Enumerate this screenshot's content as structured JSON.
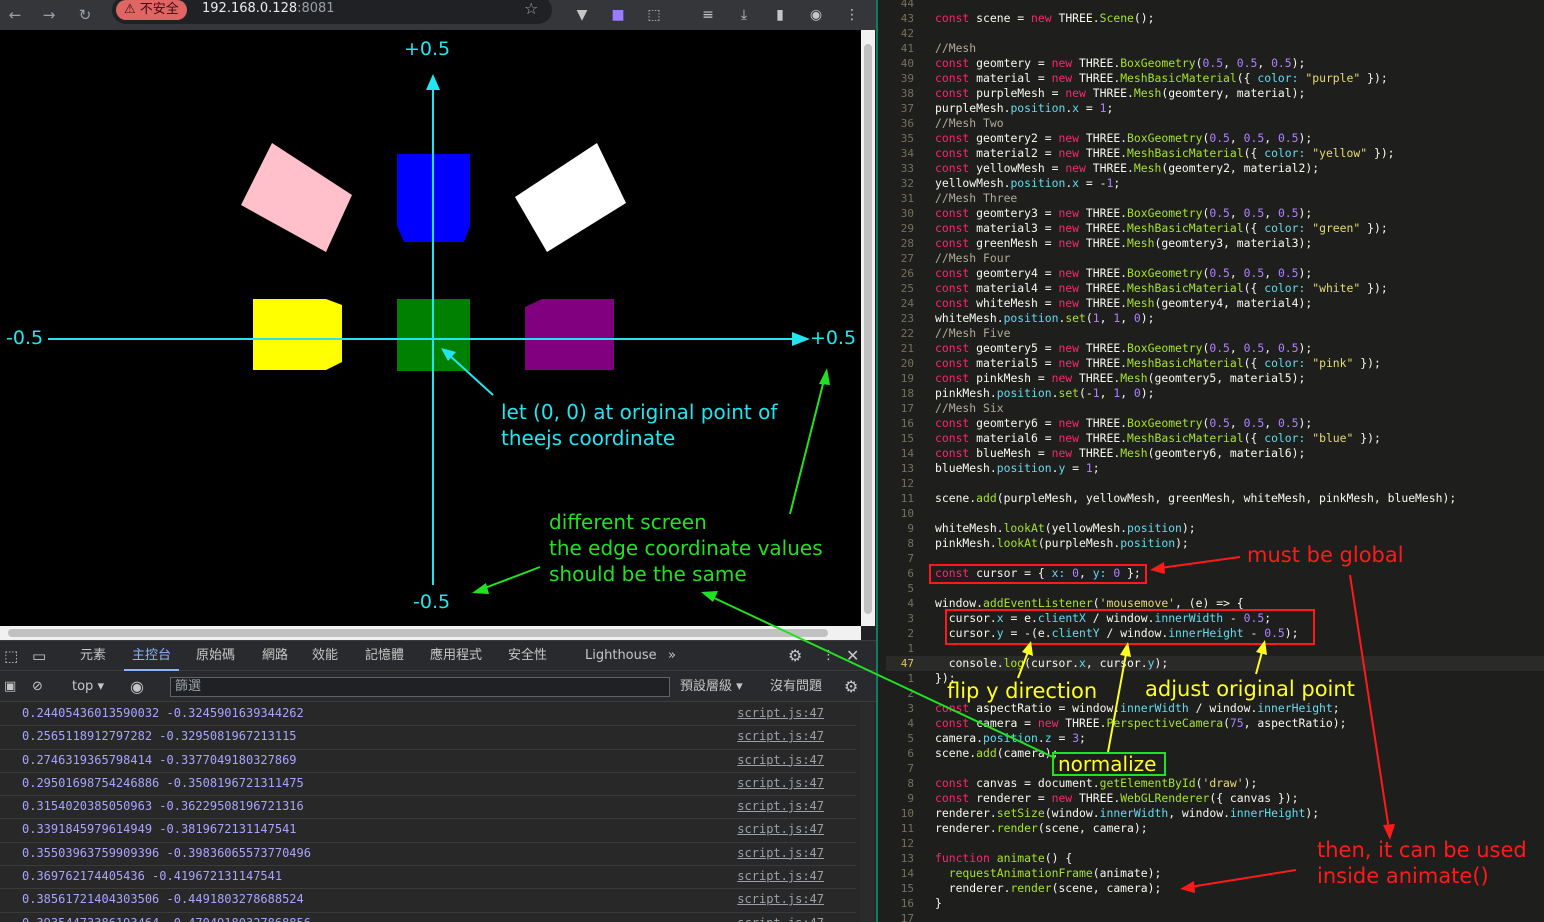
{
  "browser": {
    "insecure_label": "⚠ 不安全",
    "url_host": "192.168.0.128",
    "url_port": ":8081"
  },
  "scene": {
    "axis_labels": {
      "top": "+0.5",
      "bottom": "-0.5",
      "left": "-0.5",
      "right": "+0.5"
    },
    "note_origin": [
      "let (0, 0) at original point of",
      "theejs coordinate"
    ],
    "note_screen": [
      "different screen",
      "the edge coordinate values",
      "should be the same"
    ],
    "colors": {
      "axis": "#21e6f0",
      "note_green": "#22e022",
      "pink": "#ffc0cb",
      "blue": "#0000ff",
      "white": "#ffffff",
      "yellow": "#ffff00",
      "green": "#008000",
      "purple": "#800080"
    }
  },
  "devtools": {
    "tabs": [
      "元素",
      "主控台",
      "原始碼",
      "網路",
      "效能",
      "記憶體",
      "應用程式",
      "安全性",
      "Lighthouse"
    ],
    "active_tab": "主控台",
    "context": "top",
    "filter_placeholder": "篩選",
    "levels": "預設層級 ▾",
    "issues": "沒有問題",
    "logs": [
      {
        "msg": "0.24405436013590032 -0.3245901639344262",
        "src": "script.js:47"
      },
      {
        "msg": "0.2565118912797282 -0.3295081967213115",
        "src": "script.js:47"
      },
      {
        "msg": "0.2746319365798414 -0.3377049180327869",
        "src": "script.js:47"
      },
      {
        "msg": "0.29501698754246886 -0.3508196721311475",
        "src": "script.js:47"
      },
      {
        "msg": "0.3154020385050963 -0.36229508196721316",
        "src": "script.js:47"
      },
      {
        "msg": "0.3391845979614949 -0.3819672131147541",
        "src": "script.js:47"
      },
      {
        "msg": "0.35503963759909396 -0.39836065573770496",
        "src": "script.js:47"
      },
      {
        "msg": "0.369762174405436 -0.419672131147541",
        "src": "script.js:47"
      },
      {
        "msg": "0.38561721404303506 -0.4491803278688524",
        "src": "script.js:47"
      },
      {
        "msg": "0.39354473386193464 -0.47049180327868856",
        "src": "script.js:47"
      }
    ]
  },
  "editor": {
    "lines": [
      {
        "n": "44",
        "html": ""
      },
      {
        "n": "43",
        "html": "<span class='kw'>const</span> scene = <span class='kw'>new</span> THREE.<span class='fn'>Scene</span>();"
      },
      {
        "n": "42",
        "html": ""
      },
      {
        "n": "41",
        "html": "<span class='cm'>//Mesh</span>"
      },
      {
        "n": "40",
        "html": "<span class='kw'>const</span> geomtery = <span class='kw'>new</span> THREE.<span class='fn'>BoxGeometry</span>(<span class='num'>0.5</span>, <span class='num'>0.5</span>, <span class='num'>0.5</span>);"
      },
      {
        "n": "39",
        "html": "<span class='kw'>const</span> material = <span class='kw'>new</span> THREE.<span class='fn'>MeshBasicMaterial</span>({ <span class='prop'>color:</span> <span class='str'>\"purple\"</span> });"
      },
      {
        "n": "38",
        "html": "<span class='kw'>const</span> purpleMesh = <span class='kw'>new</span> THREE.<span class='fn'>Mesh</span>(geomtery, material);"
      },
      {
        "n": "37",
        "html": "purpleMesh.<span class='prop'>position</span>.<span class='prop'>x</span> = <span class='num'>1</span>;"
      },
      {
        "n": "36",
        "html": "<span class='cm'>//Mesh Two</span>"
      },
      {
        "n": "35",
        "html": "<span class='kw'>const</span> geomtery2 = <span class='kw'>new</span> THREE.<span class='fn'>BoxGeometry</span>(<span class='num'>0.5</span>, <span class='num'>0.5</span>, <span class='num'>0.5</span>);"
      },
      {
        "n": "34",
        "html": "<span class='kw'>const</span> material2 = <span class='kw'>new</span> THREE.<span class='fn'>MeshBasicMaterial</span>({ <span class='prop'>color:</span> <span class='str'>\"yellow\"</span> });"
      },
      {
        "n": "33",
        "html": "<span class='kw'>const</span> yellowMesh = <span class='kw'>new</span> THREE.<span class='fn'>Mesh</span>(geomtery2, material2);"
      },
      {
        "n": "32",
        "html": "yellowMesh.<span class='prop'>position</span>.<span class='prop'>x</span> = -<span class='num'>1</span>;"
      },
      {
        "n": "31",
        "html": "<span class='cm'>//Mesh Three</span>"
      },
      {
        "n": "30",
        "html": "<span class='kw'>const</span> geomtery3 = <span class='kw'>new</span> THREE.<span class='fn'>BoxGeometry</span>(<span class='num'>0.5</span>, <span class='num'>0.5</span>, <span class='num'>0.5</span>);"
      },
      {
        "n": "29",
        "html": "<span class='kw'>const</span> material3 = <span class='kw'>new</span> THREE.<span class='fn'>MeshBasicMaterial</span>({ <span class='prop'>color:</span> <span class='str'>\"green\"</span> });"
      },
      {
        "n": "28",
        "html": "<span class='kw'>const</span> greenMesh = <span class='kw'>new</span> THREE.<span class='fn'>Mesh</span>(geomtery3, material3);"
      },
      {
        "n": "27",
        "html": "<span class='cm'>//Mesh Four</span>"
      },
      {
        "n": "26",
        "html": "<span class='kw'>const</span> geomtery4 = <span class='kw'>new</span> THREE.<span class='fn'>BoxGeometry</span>(<span class='num'>0.5</span>, <span class='num'>0.5</span>, <span class='num'>0.5</span>);"
      },
      {
        "n": "25",
        "html": "<span class='kw'>const</span> material4 = <span class='kw'>new</span> THREE.<span class='fn'>MeshBasicMaterial</span>({ <span class='prop'>color:</span> <span class='str'>\"white\"</span> });"
      },
      {
        "n": "24",
        "html": "<span class='kw'>const</span> whiteMesh = <span class='kw'>new</span> THREE.<span class='fn'>Mesh</span>(geomtery4, material4);"
      },
      {
        "n": "23",
        "html": "whiteMesh.<span class='prop'>position</span>.<span class='fn'>set</span>(<span class='num'>1</span>, <span class='num'>1</span>, <span class='num'>0</span>);"
      },
      {
        "n": "22",
        "html": "<span class='cm'>//Mesh Five</span>"
      },
      {
        "n": "21",
        "html": "<span class='kw'>const</span> geomtery5 = <span class='kw'>new</span> THREE.<span class='fn'>BoxGeometry</span>(<span class='num'>0.5</span>, <span class='num'>0.5</span>, <span class='num'>0.5</span>);"
      },
      {
        "n": "20",
        "html": "<span class='kw'>const</span> material5 = <span class='kw'>new</span> THREE.<span class='fn'>MeshBasicMaterial</span>({ <span class='prop'>color:</span> <span class='str'>\"pink\"</span> });"
      },
      {
        "n": "19",
        "html": "<span class='kw'>const</span> pinkMesh = <span class='kw'>new</span> THREE.<span class='fn'>Mesh</span>(geomtery5, material5);"
      },
      {
        "n": "18",
        "html": "pinkMesh.<span class='prop'>position</span>.<span class='fn'>set</span>(-<span class='num'>1</span>, <span class='num'>1</span>, <span class='num'>0</span>);"
      },
      {
        "n": "17",
        "html": "<span class='cm'>//Mesh Six</span>"
      },
      {
        "n": "16",
        "html": "<span class='kw'>const</span> geomtery6 = <span class='kw'>new</span> THREE.<span class='fn'>BoxGeometry</span>(<span class='num'>0.5</span>, <span class='num'>0.5</span>, <span class='num'>0.5</span>);"
      },
      {
        "n": "15",
        "html": "<span class='kw'>const</span> material6 = <span class='kw'>new</span> THREE.<span class='fn'>MeshBasicMaterial</span>({ <span class='prop'>color:</span> <span class='str'>\"blue\"</span> });"
      },
      {
        "n": "14",
        "html": "<span class='kw'>const</span> blueMesh = <span class='kw'>new</span> THREE.<span class='fn'>Mesh</span>(geomtery6, material6);"
      },
      {
        "n": "13",
        "html": "blueMesh.<span class='prop'>position</span>.<span class='prop'>y</span> = <span class='num'>1</span>;"
      },
      {
        "n": "12",
        "html": ""
      },
      {
        "n": "11",
        "html": "scene.<span class='fn'>add</span>(purpleMesh, yellowMesh, greenMesh, whiteMesh, pinkMesh, blueMesh);"
      },
      {
        "n": "10",
        "html": ""
      },
      {
        "n": "9",
        "html": "whiteMesh.<span class='fn'>lookAt</span>(yellowMesh.<span class='prop'>position</span>);"
      },
      {
        "n": "8",
        "html": "pinkMesh.<span class='fn'>lookAt</span>(purpleMesh.<span class='prop'>position</span>);"
      },
      {
        "n": "7",
        "html": ""
      },
      {
        "n": "6",
        "html": "<span class='kw'>const</span> cursor = { <span class='prop'>x:</span> <span class='num'>0</span>, <span class='prop'>y:</span> <span class='num'>0</span> };"
      },
      {
        "n": "5",
        "html": ""
      },
      {
        "n": "4",
        "html": "window.<span class='fn'>addEventListener</span>(<span class='str'>'mousemove'</span>, (e) =&gt; {"
      },
      {
        "n": "3",
        "html": "  cursor.<span class='prop'>x</span> = e.<span class='prop'>clientX</span> / window.<span class='prop'>innerWidth</span> - <span class='num'>0.5</span>;"
      },
      {
        "n": "2",
        "html": "  cursor.<span class='prop'>y</span> = -(e.<span class='prop'>clientY</span> / window.<span class='prop'>innerHeight</span> - <span class='num'>0.5</span>);"
      },
      {
        "n": "1",
        "html": ""
      },
      {
        "n": "47",
        "html": "  console.<span class='fn'>log</span>(cursor.<span class='prop'>x</span>, cursor.<span class='prop'>y</span>);",
        "current": true
      },
      {
        "n": "1",
        "html": "});"
      },
      {
        "n": "2",
        "html": ""
      },
      {
        "n": "3",
        "html": "<span class='kw'>const</span> aspectRatio = window.<span class='prop'>innerWidth</span> / window.<span class='prop'>innerHeight</span>;"
      },
      {
        "n": "4",
        "html": "<span class='kw'>const</span> camera = <span class='kw'>new</span> THREE.<span class='fn'>PerspectiveCamera</span>(<span class='num'>75</span>, aspectRatio);"
      },
      {
        "n": "5",
        "html": "camera.<span class='prop'>position</span>.<span class='prop'>z</span> = <span class='num'>3</span>;"
      },
      {
        "n": "6",
        "html": "scene.<span class='fn'>add</span>(camera);"
      },
      {
        "n": "7",
        "html": ""
      },
      {
        "n": "8",
        "html": "<span class='kw'>const</span> canvas = document.<span class='fn'>getElementById</span>(<span class='str'>'draw'</span>);"
      },
      {
        "n": "9",
        "html": "<span class='kw'>const</span> renderer = <span class='kw'>new</span> THREE.<span class='fn'>WebGLRenderer</span>({ canvas });"
      },
      {
        "n": "10",
        "html": "renderer.<span class='fn'>setSize</span>(window.<span class='prop'>innerWidth</span>, window.<span class='prop'>innerHeight</span>);"
      },
      {
        "n": "11",
        "html": "renderer.<span class='fn'>render</span>(scene, camera);"
      },
      {
        "n": "12",
        "html": ""
      },
      {
        "n": "13",
        "html": "<span class='kw'>function</span> <span class='fn'>animate</span>() {"
      },
      {
        "n": "14",
        "html": "  <span class='fn'>requestAnimationFrame</span>(animate);"
      },
      {
        "n": "15",
        "html": "  renderer.<span class='fn'>render</span>(scene, camera);"
      },
      {
        "n": "16",
        "html": "}"
      },
      {
        "n": "17",
        "html": ""
      }
    ],
    "annotations": {
      "must_be_global": "must be global",
      "flip_y": "flip y direction",
      "adjust_origin": "adjust original point",
      "normalize": "normalize",
      "then_used": [
        "then, it can be used",
        "inside animate()"
      ]
    }
  }
}
